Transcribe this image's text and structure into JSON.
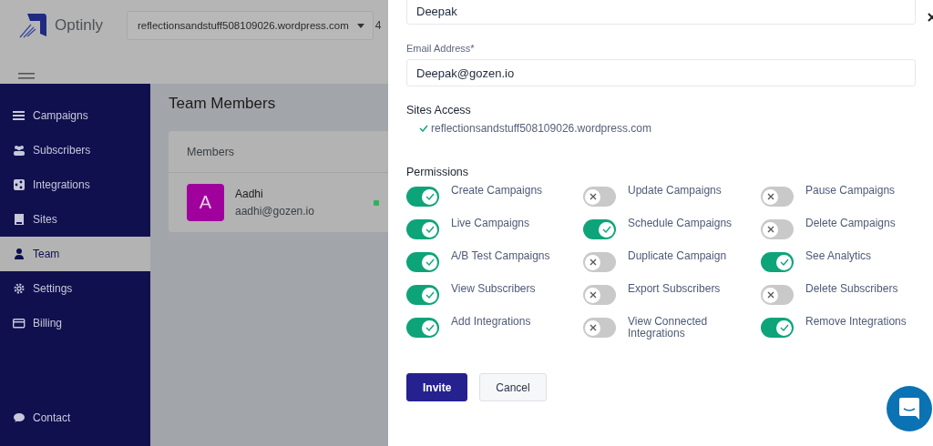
{
  "top_bar": {
    "brand": "Optinly",
    "site_select": "reflectionsandstuff508109026.wordpress.com",
    "cut_text": "4"
  },
  "sidebar": {
    "items": [
      {
        "label": "Campaigns",
        "selected": false
      },
      {
        "label": "Subscribers",
        "selected": false
      },
      {
        "label": "Integrations",
        "selected": false
      },
      {
        "label": "Sites",
        "selected": false
      },
      {
        "label": "Team",
        "selected": true
      },
      {
        "label": "Settings",
        "selected": false
      },
      {
        "label": "Billing",
        "selected": false
      }
    ],
    "footer": {
      "label": "Contact"
    }
  },
  "page": {
    "title": "Team Members",
    "members_card": {
      "heading": "Members",
      "rows": [
        {
          "initial": "A",
          "name": "Aadhi",
          "email": "aadhi@gozen.io",
          "color": "#a0009c",
          "status": {
            "color": "#2fb45a"
          }
        }
      ]
    }
  },
  "invite_panel": {
    "name_field": {
      "value": "Deepak"
    },
    "email_field": {
      "label": "Email Address*",
      "value": "Deepak@gozen.io"
    },
    "sites_access": {
      "heading": "Sites Access",
      "sites": [
        {
          "label": "reflectionsandstuff508109026.wordpress.com",
          "checked": true
        }
      ]
    },
    "permissions": {
      "heading": "Permissions",
      "items": [
        {
          "label": "Create Campaigns",
          "on": true
        },
        {
          "label": "Update Campaigns",
          "on": false
        },
        {
          "label": "Pause Campaigns",
          "on": false
        },
        {
          "label": "Live Campaigns",
          "on": true
        },
        {
          "label": "Schedule Campaigns",
          "on": true
        },
        {
          "label": "Delete Campaigns",
          "on": false
        },
        {
          "label": "A/B Test Campaigns",
          "on": true
        },
        {
          "label": "Duplicate Campaign",
          "on": false
        },
        {
          "label": "See Analytics",
          "on": true
        },
        {
          "label": "View Subscribers",
          "on": true
        },
        {
          "label": "Export Subscribers",
          "on": false
        },
        {
          "label": "Delete Subscribers",
          "on": false
        },
        {
          "label": "Add Integrations",
          "on": true
        },
        {
          "label": "View Connected Integrations",
          "on": false
        },
        {
          "label": "Remove Integrations",
          "on": true
        }
      ]
    },
    "buttons": [
      {
        "label": "Invite",
        "kind": "primary"
      },
      {
        "label": "Cancel",
        "kind": "secondary"
      }
    ]
  }
}
